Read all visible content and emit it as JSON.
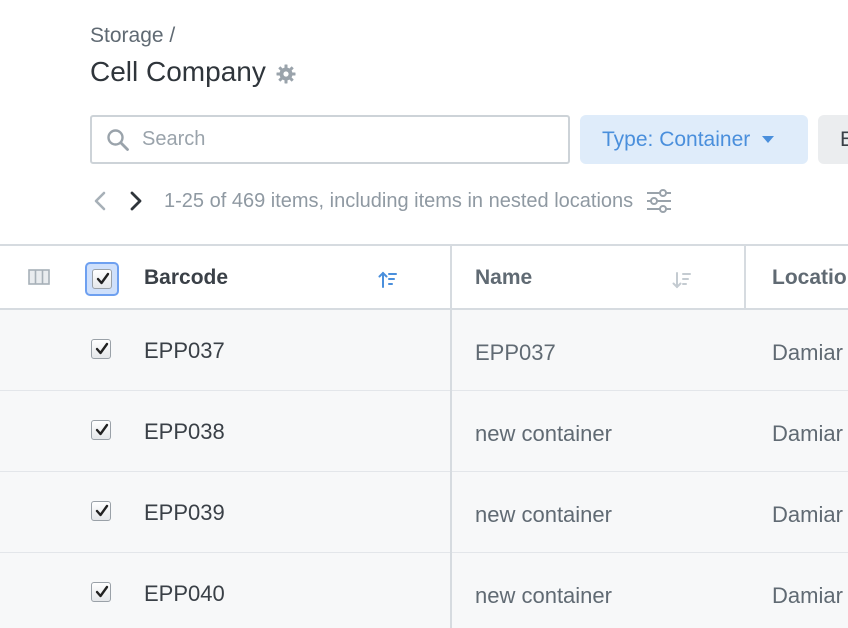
{
  "breadcrumb": {
    "parent": "Storage /"
  },
  "page": {
    "title": "Cell Company"
  },
  "search": {
    "placeholder": "Search",
    "value": ""
  },
  "filters": {
    "type_label": "Type: Container",
    "second_label": "E"
  },
  "pagination": {
    "info": "1-25 of 469 items, including items in nested locations"
  },
  "table": {
    "headers": {
      "barcode": "Barcode",
      "name": "Name",
      "location": "Locatio"
    },
    "rows": [
      {
        "barcode": "EPP037",
        "name": "EPP037",
        "location": "Damiar",
        "checked": true
      },
      {
        "barcode": "EPP038",
        "name": "new container",
        "location": "Damiar",
        "checked": true
      },
      {
        "barcode": "EPP039",
        "name": "new container",
        "location": "Damiar",
        "checked": true
      },
      {
        "barcode": "EPP040",
        "name": "new container",
        "location": "Damiar",
        "checked": true
      }
    ]
  },
  "colors": {
    "accent": "#4a8fdc",
    "filter_bg": "#dfecfa",
    "row_bg": "#f7f8f9"
  },
  "icons": [
    "gear-icon",
    "search-icon",
    "chevron-left-icon",
    "chevron-right-icon",
    "sliders-icon",
    "columns-icon",
    "sort-asc-icon",
    "sort-desc-icon",
    "checkmark-icon"
  ]
}
